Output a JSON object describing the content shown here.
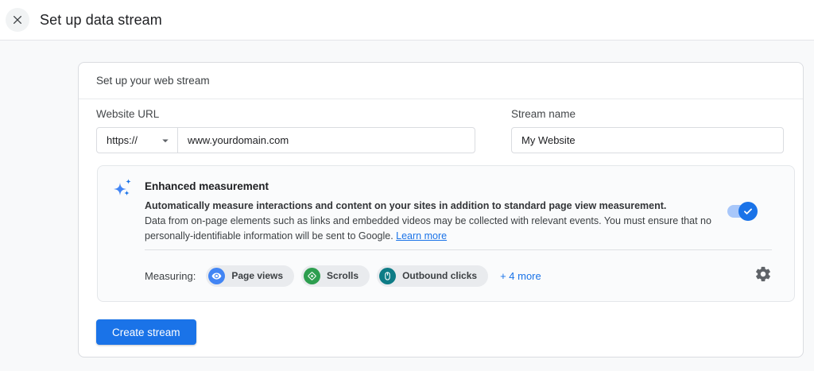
{
  "topbar": {
    "title": "Set up data stream",
    "close_icon": "close-x"
  },
  "card": {
    "header": "Set up your web stream"
  },
  "form": {
    "website_url_label": "Website URL",
    "protocol_value": "https://",
    "url_value": "www.yourdomain.com",
    "stream_name_label": "Stream name",
    "stream_name_value": "My Website"
  },
  "enhanced": {
    "title": "Enhanced measurement",
    "desc_bold": "Automatically measure interactions and content on your sites in addition to standard page view measurement.",
    "desc_body": "Data from on-page elements such as links and embedded videos may be collected with relevant events. You must ensure that no personally-identifiable information will be sent to Google. ",
    "learn_more": "Learn more",
    "toggle_state": "on",
    "measuring_label": "Measuring:",
    "chips": [
      {
        "label": "Page views",
        "icon": "eye-icon",
        "color": "#4285f4"
      },
      {
        "label": "Scrolls",
        "icon": "scroll-diamond-icon",
        "color": "#2d9e4f"
      },
      {
        "label": "Outbound clicks",
        "icon": "mouse-icon",
        "color": "#0e7c86"
      }
    ],
    "more_label": "+ 4 more"
  },
  "actions": {
    "create_button": "Create stream"
  },
  "colors": {
    "accent_blue": "#1a73e8",
    "toggle_track": "#a8c7fa",
    "chip_background": "#e9ebee",
    "page_background": "#f8f9fa"
  }
}
